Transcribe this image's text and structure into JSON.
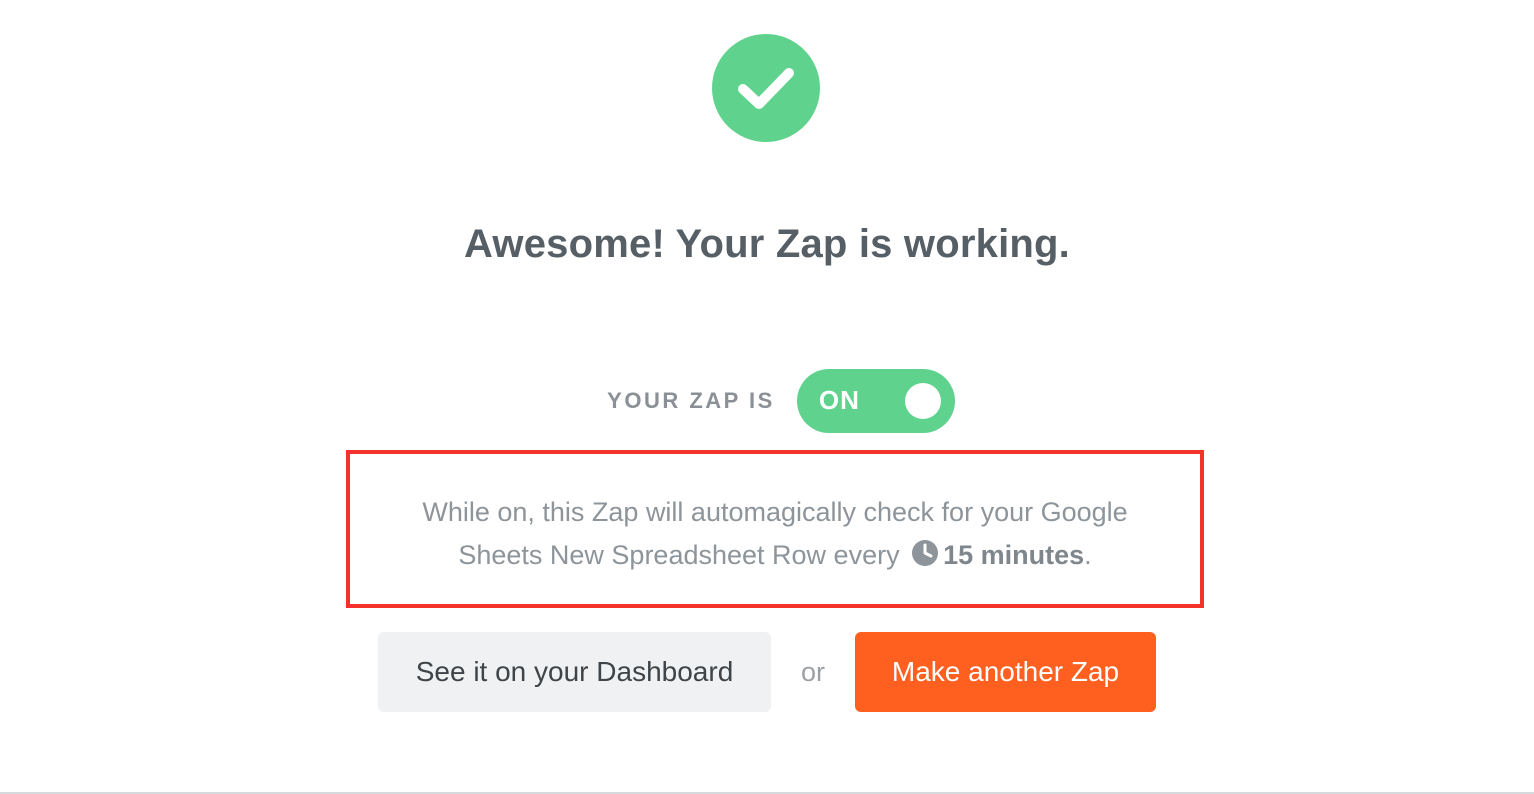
{
  "success": {
    "icon": "check-icon",
    "color": "#5fd38d",
    "headline": "Awesome! Your Zap is working."
  },
  "status": {
    "label": "YOUR ZAP IS",
    "toggle_label": "ON",
    "is_on": true,
    "toggle_color": "#5fd38d"
  },
  "info": {
    "line1": "While on, this Zap will automagically check for your Google",
    "line2_prefix": "Sheets New Spreadsheet Row every",
    "clock_icon": "clock-icon",
    "interval": "15 minutes",
    "suffix": ".",
    "highlight_color": "#f3332a"
  },
  "actions": {
    "dashboard_label": "See it on your Dashboard",
    "or_label": "or",
    "make_another_label": "Make another Zap",
    "primary_color": "#ff5f1f"
  }
}
